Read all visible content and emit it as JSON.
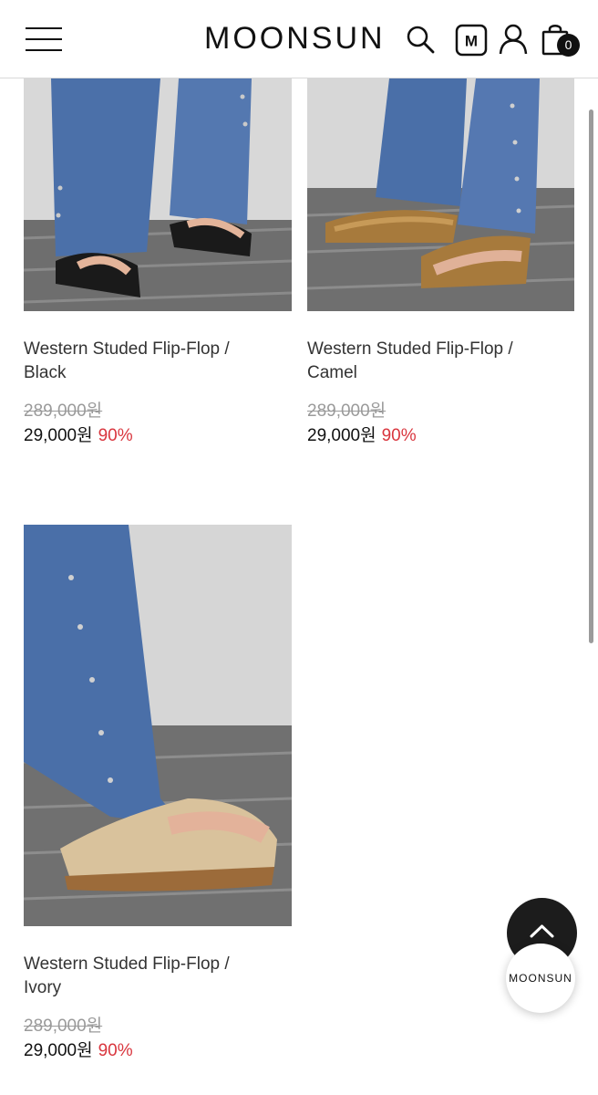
{
  "header": {
    "brand": "MOONSUN",
    "cart_count": "0",
    "icons": [
      "menu-icon",
      "search-icon",
      "membership-m-icon",
      "user-icon",
      "cart-bag-icon"
    ]
  },
  "products": [
    {
      "name_line1": "Western Studed Flip-Flop /",
      "name_line2": "Black",
      "original_price": "289,000원",
      "sale_price": "29,000원",
      "discount": "90%"
    },
    {
      "name_line1": "Western Studed Flip-Flop /",
      "name_line2": "Camel",
      "original_price": "289,000원",
      "sale_price": "29,000원",
      "discount": "90%"
    },
    {
      "name_line1": "Western Studed Flip-Flop /",
      "name_line2": "Ivory",
      "original_price": "289,000원",
      "sale_price": "29,000원",
      "discount": "90%"
    }
  ],
  "floating": {
    "brand_button": "MOONSUN",
    "top_icon": "chevron-up-icon"
  },
  "colors": {
    "discount": "#d9363e",
    "denim": "#4a6fa8",
    "floor": "#6d6d6d",
    "header_border": "#d9d9d9"
  }
}
